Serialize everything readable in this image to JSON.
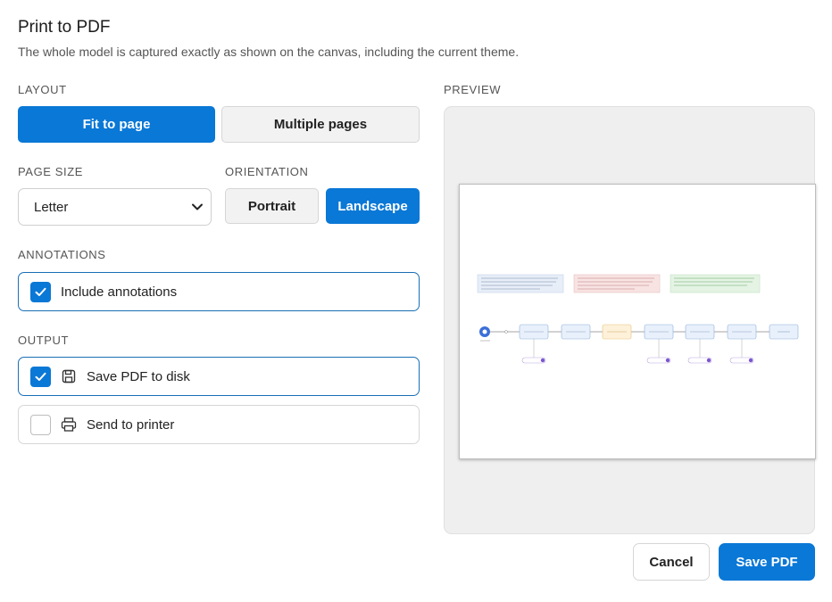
{
  "dialog": {
    "title": "Print to PDF",
    "subtitle": "The whole model is captured exactly as shown on the canvas, including the current theme."
  },
  "layout": {
    "label": "LAYOUT",
    "fit_to_page": "Fit to page",
    "multiple_pages": "Multiple pages",
    "selected": "Fit to page"
  },
  "page_size": {
    "label": "PAGE SIZE",
    "value": "Letter"
  },
  "orientation": {
    "label": "ORIENTATION",
    "portrait": "Portrait",
    "landscape": "Landscape",
    "selected": "Landscape"
  },
  "annotations": {
    "label": "ANNOTATIONS",
    "include_label": "Include annotations",
    "include_checked": true
  },
  "output": {
    "label": "OUTPUT",
    "save_to_disk_label": "Save PDF to disk",
    "save_to_disk_checked": true,
    "send_to_printer_label": "Send to printer",
    "send_to_printer_checked": false
  },
  "preview": {
    "label": "PREVIEW"
  },
  "footer": {
    "cancel": "Cancel",
    "save": "Save PDF"
  },
  "colors": {
    "accent": "#0a78d6",
    "selected_border": "#1a6fb5"
  }
}
